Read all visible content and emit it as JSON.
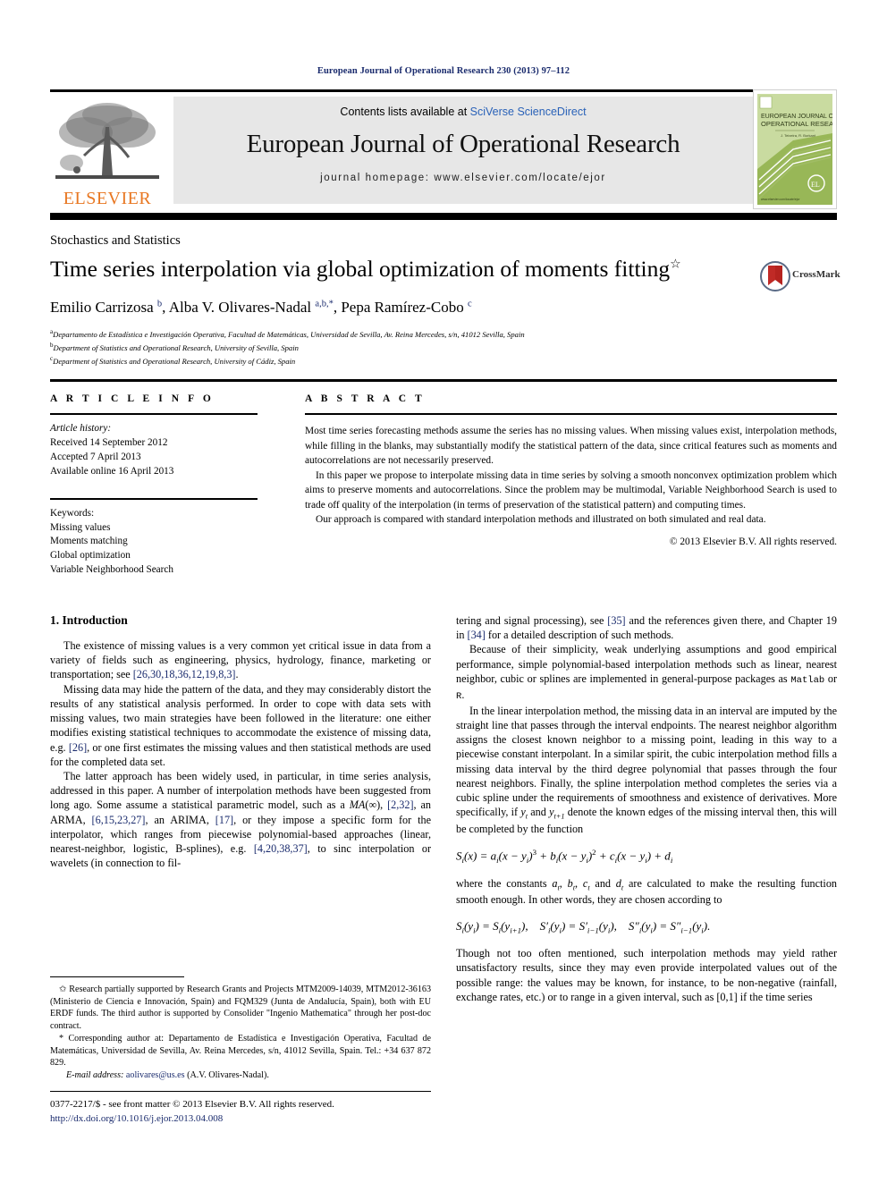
{
  "running_head": "European Journal of Operational Research 230 (2013) 97–112",
  "masthead": {
    "contents_prefix": "Contents lists available at ",
    "contents_link": "SciVerse ScienceDirect",
    "journal_title": "European Journal of Operational Research",
    "homepage": "journal homepage: www.elsevier.com/locate/ejor",
    "publisher_wordmark": "ELSEVIER",
    "publisher_logo_icon": "elsevier-tree-icon",
    "cover_title_line1": "EUROPEAN JOURNAL OF",
    "cover_title_line2": "OPERATIONAL RESEARCH"
  },
  "article": {
    "section_kicker": "Stochastics and Statistics",
    "title": "Time series interpolation via global optimization of moments fitting",
    "title_footnote_marker": "☆",
    "authors_html": "Emilio Carrizosa <sup>b</sup>, Alba V. Olivares-Nadal <sup>a,b,*</sup>, Pepa Ramírez-Cobo <sup>c</sup>",
    "affiliations": [
      {
        "marker": "a",
        "text": "Departamento de Estadística e Investigación Operativa, Facultad de Matemáticas, Universidad de Sevilla, Av. Reina Mercedes, s/n, 41012 Sevilla, Spain"
      },
      {
        "marker": "b",
        "text": "Department of Statistics and Operational Research, University of Sevilla, Spain"
      },
      {
        "marker": "c",
        "text": "Department of Statistics and Operational Research, University of Cádiz, Spain"
      }
    ],
    "crossmark_label": "CrossMark"
  },
  "info": {
    "heading": "A R T I C L E   I N F O",
    "history_label": "Article history:",
    "history": [
      "Received 14 September 2012",
      "Accepted 7 April 2013",
      "Available online 16 April 2013"
    ],
    "keywords_label": "Keywords:",
    "keywords": [
      "Missing values",
      "Moments matching",
      "Global optimization",
      "Variable Neighborhood Search"
    ]
  },
  "abstract": {
    "heading": "A B S T R A C T",
    "paragraphs": [
      "Most time series forecasting methods assume the series has no missing values. When missing values exist, interpolation methods, while filling in the blanks, may substantially modify the statistical pattern of the data, since critical features such as moments and autocorrelations are not necessarily preserved.",
      "In this paper we propose to interpolate missing data in time series by solving a smooth nonconvex optimization problem which aims to preserve moments and autocorrelations. Since the problem may be multimodal, Variable Neighborhood Search is used to trade off quality of the interpolation (in terms of preservation of the statistical pattern) and computing times.",
      "Our approach is compared with standard interpolation methods and illustrated on both simulated and real data."
    ],
    "copyright": "© 2013 Elsevier B.V. All rights reserved."
  },
  "body": {
    "section_number_title": "1. Introduction",
    "left_paragraphs": [
      "The existence of missing values is a very common yet critical issue in data from a variety of fields such as engineering, physics, hydrology, finance, marketing or transportation; see [26,30,18,36,12,19,8,3].",
      "Missing data may hide the pattern of the data, and they may considerably distort the results of any statistical analysis performed. In order to cope with data sets with missing values, two main strategies have been followed in the literature: one either modifies existing statistical techniques to accommodate the existence of missing data, e.g. [26], or one first estimates the missing values and then statistical methods are used for the completed data set.",
      "The latter approach has been widely used, in particular, in time series analysis, addressed in this paper. A number of interpolation methods have been suggested from long ago. Some assume a statistical parametric model, such as a MA(∞), [2,32], an ARMA, [6,15,23,27], an ARIMA, [17], or they impose a specific form for the interpolator, which ranges from piecewise polynomial-based approaches (linear, nearest-neighbor, logistic, B-splines), e.g. [4,20,38,37], to sinc interpolation or wavelets (in connection to fil-"
    ],
    "right_paragraphs": [
      "tering and signal processing), see [35] and the references given there, and Chapter 19 in [34] for a detailed description of such methods.",
      "Because of their simplicity, weak underlying assumptions and good empirical performance, simple polynomial-based interpolation methods such as linear, nearest neighbor, cubic or splines are implemented in general-purpose packages as Matlab or R.",
      "In the linear interpolation method, the missing data in an interval are imputed by the straight line that passes through the interval endpoints. The nearest neighbor algorithm assigns the closest known neighbor to a missing point, leading in this way to a piecewise constant interpolant. In a similar spirit, the cubic interpolation method fills a missing data interval by the third degree polynomial that passes through the four nearest neighbors. Finally, the spline interpolation method completes the series via a cubic spline under the requirements of smoothness and existence of derivatives. More specifically, if yt and yt+1 denote the known edges of the missing interval then, this will be completed by the function",
      "where the constants at, bt, ct and dt are calculated to make the resulting function smooth enough. In other words, they are chosen according to",
      "Though not too often mentioned, such interpolation methods may yield rather unsatisfactory results, since they may even provide interpolated values out of the possible range: the values may be known, for instance, to be non-negative (rainfall, exchange rates, etc.) or to range in a given interval, such as [0,1] if the time series"
    ],
    "equation_1": "Si(x) = ai(x − yi)³ + bi(x − yi)² + ci(x − yi) + di",
    "equation_2": "Si(yi) = Si(yi+1),   S′i(yi) = S′i−1(yi),   S″i(yi) = S″i−1(yi)."
  },
  "footnotes": {
    "grant_marker": "✩",
    "grant": "Research partially supported by Research Grants and Projects MTM2009-14039, MTM2012-36163 (Ministerio de Ciencia e Innovación, Spain) and FQM329 (Junta de Andalucía, Spain), both with EU ERDF funds. The third author is supported by Consolider \"Ingenio Mathematica\" through her post-doc contract.",
    "corresponding_marker": "*",
    "corresponding": "Corresponding author at: Departamento de Estadística e Investigación Operativa, Facultad de Matemáticas, Universidad de Sevilla, Av. Reina Mercedes, s/n, 41012 Sevilla, Spain. Tel.: +34 637 872 829.",
    "email_label": "E-mail address:",
    "email": "aolivares@us.es",
    "email_owner": "(A.V. Olivares-Nadal)."
  },
  "footer": {
    "issn_line": "0377-2217/$ - see front matter © 2013 Elsevier B.V. All rights reserved.",
    "doi": "http://dx.doi.org/10.1016/j.ejor.2013.04.008"
  },
  "colors": {
    "link_blue": "#2a62b8",
    "reference_blue": "#1a2b6d",
    "elsevier_orange": "#e87722",
    "panel_grey": "#e7e7e7",
    "cover_green": "#a8c256",
    "crossmark_red": "#b5231f"
  }
}
